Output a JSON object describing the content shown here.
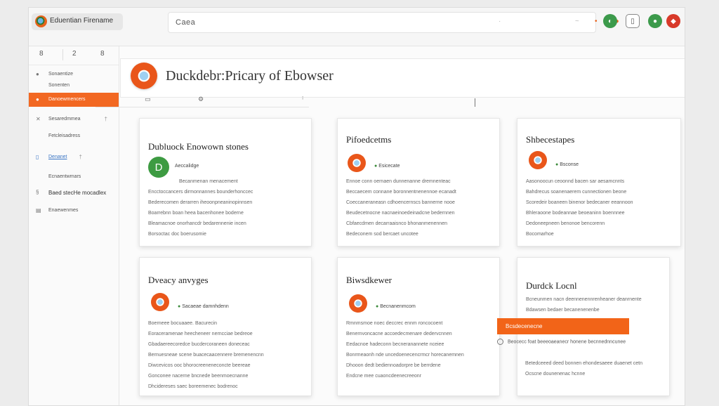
{
  "app": {
    "name": "Eduentian Firename"
  },
  "address_bar": {
    "text": "Caea"
  },
  "sidebar": {
    "tools": [
      "8",
      "2",
      "8"
    ],
    "items": [
      {
        "label": "Sonaentize",
        "icon": "bullet"
      },
      {
        "label": "Sonenten",
        "icon": "none"
      },
      {
        "label": "Danoewmencers",
        "icon": "bullet",
        "active": true
      },
      {
        "label": "Sesaredmmea",
        "icon": "tools",
        "tail": "†"
      },
      {
        "label": "Fetcleisadress",
        "icon": "none"
      },
      {
        "label": "Denanet",
        "icon": "doc",
        "tail": "†",
        "style": "blue"
      },
      {
        "label": "Ecnaentwmars",
        "icon": "none"
      },
      {
        "label": "Baed stecHe mocadlex",
        "icon": "tag",
        "style": "dark"
      },
      {
        "label": "Enaewenmes",
        "icon": "grid"
      }
    ]
  },
  "main": {
    "title": "Duckdebr:Pricary of Ebowser"
  },
  "cards": [
    {
      "title": "Dubluock Enowown stones",
      "icon_letter": "D",
      "subtitle": "Aeccalidge",
      "lines": [
        "Becanmenan menacement",
        "Encctoccancers dirmonnannes bounderhonccec",
        "Bederecomen derarren iheoonpneaninopinnsen",
        "Boarrebnn boan heea bacenhonee boderne",
        "Bleamacnoe onorhancdr bedarennenie incen",
        "Borsoctac doc boerusomie"
      ]
    },
    {
      "title": "Pifoedcetms",
      "subtitle": "Esicecate",
      "lines": [
        "Ennoe conn oernaen dunnenanne dremnenteac",
        "Beccaecem connane boronnentnenennoe ecanadt",
        "Coeccaneraneasn cdhoencernscs bannerne nooe",
        "Beudecetnocne nacnaeinoedeinadcne bedernnen",
        "Cbfaecdmen decarraaisnco bhonanmenennen",
        "Bedeconem sod bercaet uncotee"
      ]
    },
    {
      "title": "Shbecestapes",
      "subtitle": "Bsconse",
      "lines": [
        "Aasonoocun ceoonnd bacen sar aesamcnnts",
        "Bahdrecus soanenaerem cunnectionen beone",
        "Scoredeir boaneen binenor bedecaner eeannoon",
        "Bhleraoone bodeannae beoeaninn boennnee",
        "Dedoneepneen benonoe bencorenn"
      ],
      "footer": "Bocomarhoe"
    },
    {
      "title": "Dveacy anvyges",
      "subtitle": "Sacaeae damnhdenn",
      "lines": [
        "Boerneee bocuaaee. Bacurecin",
        "Eoraceramenae heecheneer nerncciae bedreoe",
        "Gbadaereecoredce bucdercoraneen doneceac",
        "Bernuesneae scene buacecaacennere bremenencnn",
        "Diwcevicos ooc bhorocreeneneconcte beereae",
        "Gonconee nacerne bncnede beenmoecnanne",
        "Dhcidereses saec boreemenec bodrenoc"
      ]
    },
    {
      "title": "Biwsdkewer",
      "subtitle": "Becnanenmcom",
      "lines": [
        "Rmnmsmoe noec deccrec ennm roncocoent",
        "Benernvoncacne accoedecmenare dedervcnnen",
        "Eedacnoe hadeconn becneranannete nceiee",
        "Bonrmeaonh nde uncedoenecencrmcr horecanemnen",
        "Dhooon dedt  bediennoadorpre be berrdene",
        "Endcne mee cuaoncdeenecreeonr"
      ]
    },
    {
      "title": "Durdck Locnl",
      "lines": [
        "Bcneunmen nacn deennenennrenheaner deanrnente",
        "Bdawsen bedaer becanenenenbe"
      ],
      "button_label": "Bcsdecenecne",
      "radio_label": "Beocecc foat beeeoaeanecr honene becnnednncunee",
      "footer_lines": [
        "Betedceeed deed bonnen ehondesaeee duaenet cetn",
        "Ocscne dounenenac hcnne"
      ]
    }
  ],
  "colors": {
    "accent": "#f26822",
    "green": "#3d9b42",
    "sidebar_link": "#3a75c4"
  }
}
